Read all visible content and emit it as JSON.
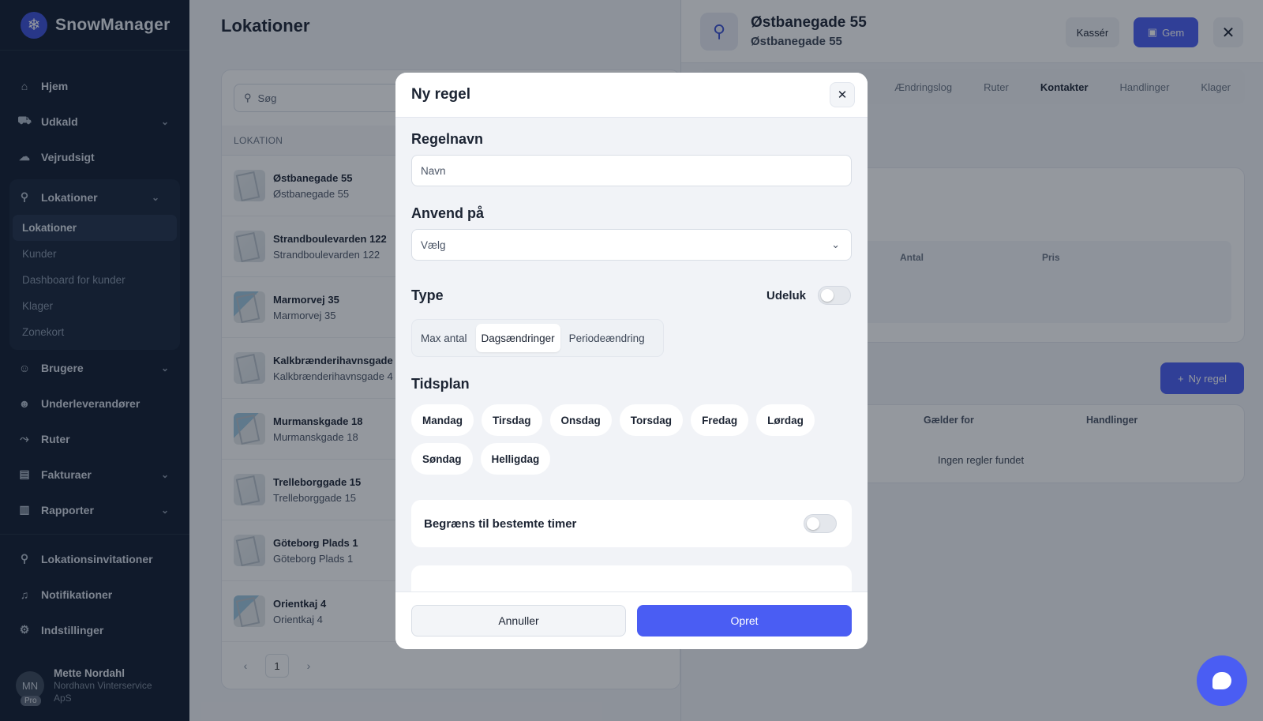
{
  "brand": {
    "name": "SnowManager"
  },
  "sidebar": {
    "items": [
      {
        "label": "Hjem",
        "icon": "home-icon"
      },
      {
        "label": "Udkald",
        "icon": "truck-icon",
        "expandable": true
      },
      {
        "label": "Vejrudsigt",
        "icon": "cloud-icon"
      }
    ],
    "locations_group": {
      "label": "Lokationer",
      "sub": [
        "Lokationer",
        "Kunder",
        "Dashboard for kunder",
        "Klager",
        "Zonekort"
      ],
      "active_sub": "Lokationer"
    },
    "items2": [
      {
        "label": "Brugere",
        "expandable": true
      },
      {
        "label": "Underleverandører"
      },
      {
        "label": "Ruter"
      },
      {
        "label": "Fakturaer",
        "expandable": true
      },
      {
        "label": "Rapporter",
        "expandable": true
      }
    ],
    "items3": [
      {
        "label": "Lokationsinvitationer"
      },
      {
        "label": "Notifikationer"
      },
      {
        "label": "Indstillinger"
      }
    ],
    "user": {
      "name": "Mette Nordahl",
      "company_line1": "Nordhavn Vinterservice",
      "company_line2": "ApS",
      "initials": "MN",
      "badge": "Pro"
    }
  },
  "main": {
    "title": "Lokationer",
    "search_placeholder": "Søg",
    "column": "LOKATION",
    "rows": [
      {
        "name": "Østbanegade 55",
        "address": "Østbanegade 55"
      },
      {
        "name": "Strandboulevarden 122",
        "address": "Strandboulevarden 122"
      },
      {
        "name": "Marmorvej 35",
        "address": "Marmorvej 35"
      },
      {
        "name": "Kalkbrænderihavnsgade 4",
        "address": "Kalkbrænderihavnsgade 4"
      },
      {
        "name": "Murmanskgade 18",
        "address": "Murmanskgade 18"
      },
      {
        "name": "Trelleborggade 15",
        "address": "Trelleborggade 15"
      },
      {
        "name": "Göteborg Plads 1",
        "address": "Göteborg Plads 1"
      },
      {
        "name": "Orientkaj 4",
        "address": "Orientkaj 4"
      }
    ],
    "page": "1"
  },
  "panel": {
    "title": "Østbanegade 55",
    "subtitle": "Østbanegade 55",
    "cancel": "Kassér",
    "save": "Gem",
    "tabs": [
      "Ændringslog",
      "Ruter",
      "Kontakter",
      "Handlinger",
      "Klager"
    ],
    "active_tab": "Kontakter",
    "table1_headers": [
      "Antal",
      "Pris"
    ],
    "new_rule": "Ny regel",
    "table2_headers": [
      "Gælder for",
      "Handlinger"
    ],
    "empty": "Ingen regler fundet"
  },
  "modal": {
    "title": "Ny regel",
    "rule_name_label": "Regelnavn",
    "rule_name_placeholder": "Navn",
    "apply_label": "Anvend på",
    "apply_value": "Vælg",
    "type_label": "Type",
    "exclude_label": "Udeluk",
    "type_options": [
      "Max antal",
      "Dagsændringer",
      "Periodeændring"
    ],
    "type_selected": "Dagsændringer",
    "schedule_label": "Tidsplan",
    "days": [
      "Mandag",
      "Tirsdag",
      "Onsdag",
      "Torsdag",
      "Fredag",
      "Lørdag",
      "Søndag",
      "Helligdag"
    ],
    "limit_hours_label": "Begræns til bestemte timer",
    "cancel": "Annuller",
    "create": "Opret"
  }
}
